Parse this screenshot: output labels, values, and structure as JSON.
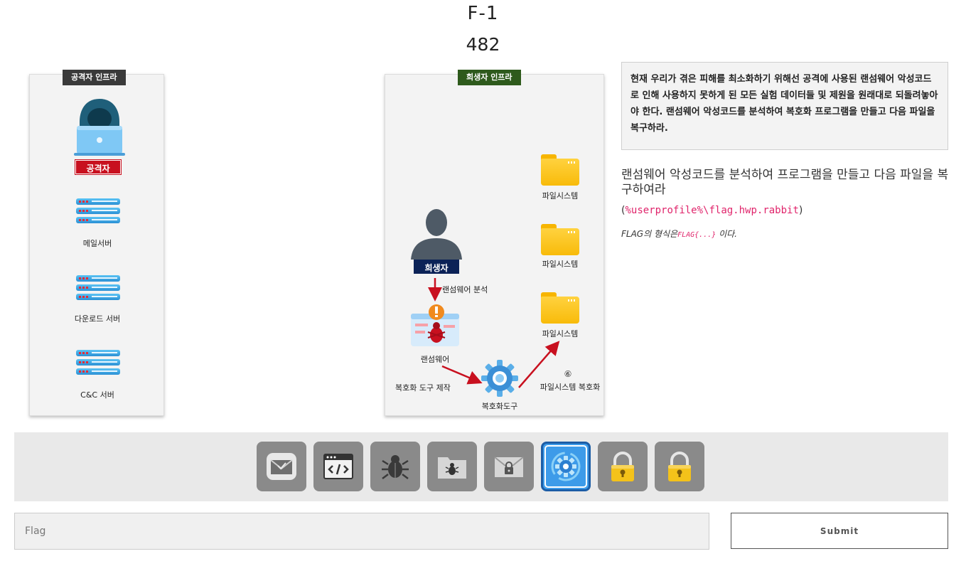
{
  "challenge": {
    "code": "F-1",
    "points": "482"
  },
  "left_panel": {
    "title": "공격자 인프라",
    "attacker_label": "공격자",
    "servers": [
      "메일서버",
      "다운로드 서버",
      "C&C 서버"
    ]
  },
  "right_panel": {
    "title": "희생자 인프라",
    "victim_label": "희생자",
    "analysis_label": "랜섬웨어 분석",
    "ransomware_label": "랜섬웨어",
    "tool_make_label": "복호화 도구 제작",
    "tool_label": "복호화도구",
    "step_number": "⑥",
    "restore_label": "파일시스템 복호화",
    "filesystems": [
      "파일시스템",
      "파일시스템",
      "파일시스템"
    ]
  },
  "description": {
    "box_text": "현재 우리가 겪은 피해를 최소화하기 위해선 공격에 사용된 랜섬웨어 악성코드로 인해 사용하지 못하게 된 모든 실험 데이터들 및 제원을 원래대로 되돌려놓아야 한다. 랜섬웨어 악성코드를 분석하여 복호화 프로그램을 만들고 다음 파일을 복구하라.",
    "task_text": "랜섬웨어 악성코드를 분석하여 프로그램을 만들고 다음 파일을 복구하여라",
    "path_open": "(",
    "path": "%userprofile%\\flag.hwp.rabbit",
    "path_close": ")",
    "flag_prefix": "FLAG의 형식은",
    "flag_format": "FLAG{...}",
    "flag_suffix": "이다."
  },
  "toolbar": {
    "icons": [
      "mail-icon",
      "code-icon",
      "bug-icon",
      "bug-folder-icon",
      "locked-mail-icon",
      "gear-refresh-icon",
      "padlock-icon",
      "padlock-icon"
    ],
    "active_index": 5
  },
  "form": {
    "flag_placeholder": "Flag",
    "submit_label": "Submit"
  }
}
